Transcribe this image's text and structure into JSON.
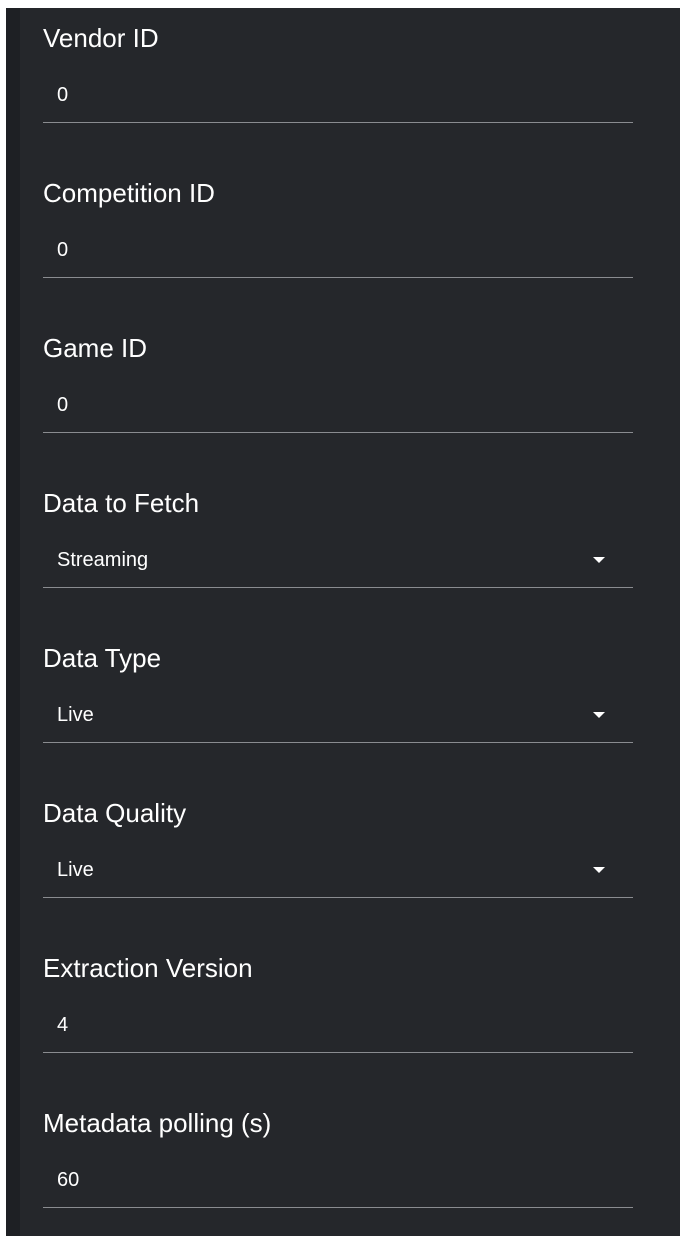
{
  "settings_form": {
    "vendor_id": {
      "label": "Vendor ID",
      "value": "0"
    },
    "competition_id": {
      "label": "Competition ID",
      "value": "0"
    },
    "game_id": {
      "label": "Game ID",
      "value": "0"
    },
    "data_to_fetch": {
      "label": "Data to Fetch",
      "value": "Streaming"
    },
    "data_type": {
      "label": "Data Type",
      "value": "Live"
    },
    "data_quality": {
      "label": "Data Quality",
      "value": "Live"
    },
    "extraction_version": {
      "label": "Extraction Version",
      "value": "4"
    },
    "metadata_polling": {
      "label": "Metadata polling (s)",
      "value": "60"
    }
  },
  "icons": {
    "dropdown": "caret-down-icon"
  },
  "colors": {
    "panel_background": "#25272b",
    "text": "#ffffff",
    "underline": "#8a8c90"
  }
}
